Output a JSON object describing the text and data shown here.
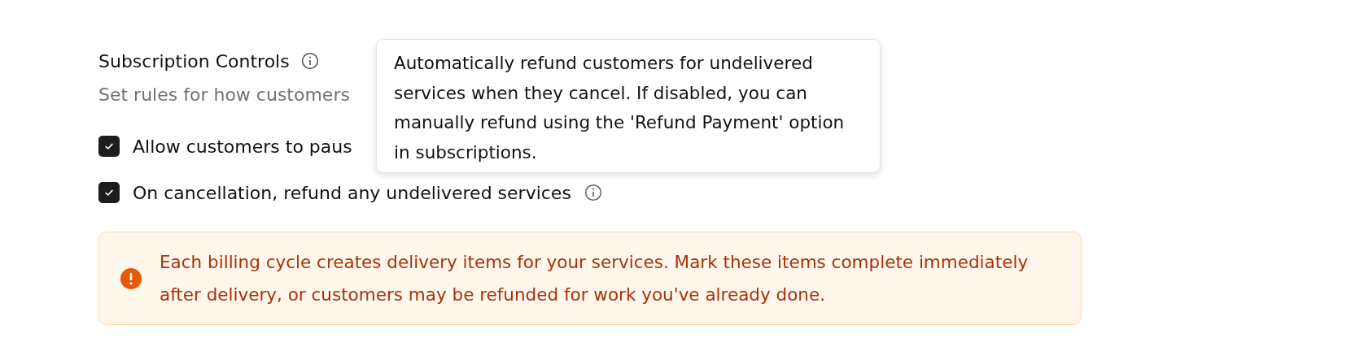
{
  "section": {
    "title": "Subscription Controls",
    "subtitle": "Set rules for how customers"
  },
  "options": [
    {
      "label": "Allow customers to paus",
      "checked": true,
      "info": false
    },
    {
      "label": "On cancellation, refund any undelivered services",
      "checked": true,
      "info": true
    }
  ],
  "tooltip": {
    "text": "Automatically refund customers for undelivered services when they cancel. If disabled, you can manually refund using the 'Refund Payment' option in subscriptions."
  },
  "alert": {
    "text": "Each billing cycle creates delivery items for your services. Mark these items complete immediately after delivery, or customers may be refunded for work you've already done."
  }
}
